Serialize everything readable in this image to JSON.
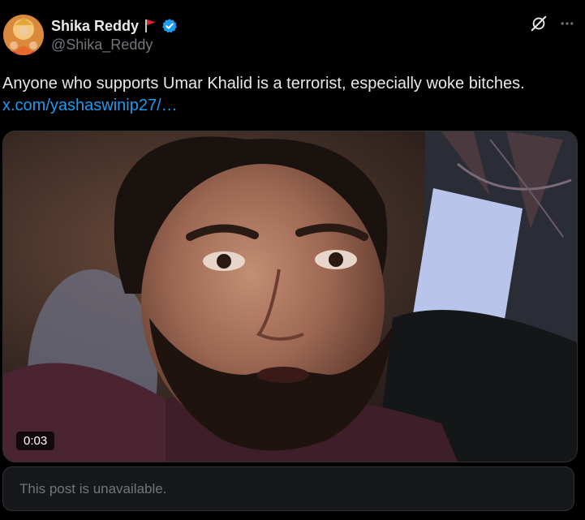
{
  "author": {
    "display_name": "Shika Reddy",
    "handle": "@Shika_Reddy",
    "flag_icon": "red-flag-icon",
    "verified_icon": "verified-badge-icon",
    "verified_color": "#1d9bf0"
  },
  "actions": {
    "grok_icon": "grok-icon",
    "more_icon": "more-dots-icon"
  },
  "post": {
    "text": "Anyone who supports Umar Khalid is a terrorist, especially woke bitches.",
    "link": "x.com/yashaswinip27/…",
    "link_color": "#1d9bf0"
  },
  "media": {
    "type": "video",
    "duration": "0:03"
  },
  "quoted_post": {
    "status_text": "This post is unavailable."
  }
}
